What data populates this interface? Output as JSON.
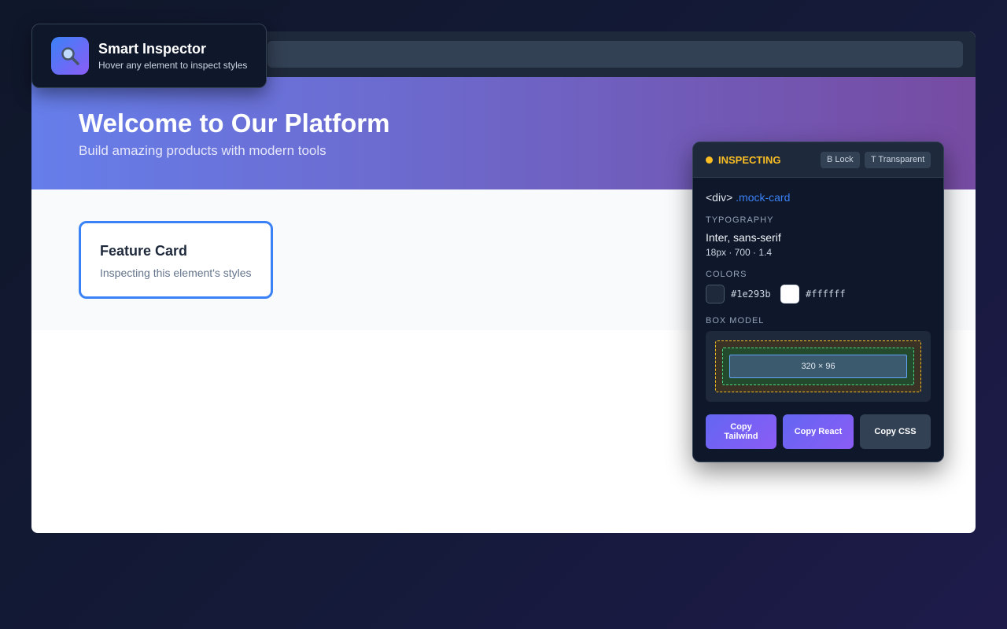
{
  "extension": {
    "name": "Smart Inspector",
    "tagline": "Hover any element to inspect styles",
    "logo_icon": "magnifier-icon"
  },
  "page": {
    "hero": {
      "title": "Welcome to Our Platform",
      "subtitle": "Build amazing products with modern tools"
    },
    "card": {
      "title": "Feature Card",
      "description": "Inspecting this element's styles"
    }
  },
  "inspector": {
    "status": "INSPECTING",
    "shortcuts": {
      "lock": "B Lock",
      "transparent": "T Transparent"
    },
    "element": {
      "tag": "<div>",
      "class_name": ".mock-card"
    },
    "typography": {
      "label": "TYPOGRAPHY",
      "font_family": "Inter, sans-serif",
      "metrics": "18px · 700 · 1.4"
    },
    "colors": {
      "label": "COLORS",
      "text_color": "#1e293b",
      "background_color": "#ffffff"
    },
    "box_model": {
      "label": "BOX MODEL",
      "dimensions": "320 × 96"
    },
    "actions": {
      "copy_tailwind": "Copy Tailwind",
      "copy_react": "Copy React",
      "copy_css": "Copy CSS"
    }
  },
  "theme": {
    "accent": "#3b82f6",
    "status": "#fbbf24",
    "hero_gradient_start": "#667eea",
    "hero_gradient_end": "#764ba2"
  }
}
